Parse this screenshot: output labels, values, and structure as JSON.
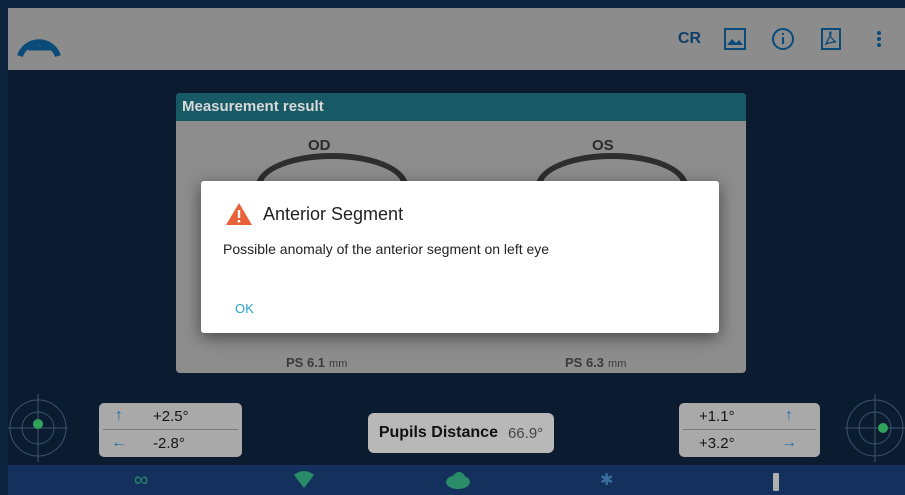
{
  "header": {
    "cr_label": "CR",
    "icons": [
      "app-logo",
      "gallery-icon",
      "info-icon",
      "pdf-icon",
      "more-vert-icon"
    ]
  },
  "card": {
    "title": "Measurement result",
    "od_label": "OD",
    "os_label": "OS",
    "od_ps_label": "PS",
    "od_ps_value": "6.1",
    "od_ps_unit": "mm",
    "os_ps_label": "PS",
    "os_ps_value": "6.3",
    "os_ps_unit": "mm"
  },
  "dialog": {
    "title": "Anterior Segment",
    "message": "Possible anomaly of the anterior segment on left eye",
    "ok_label": "OK",
    "warning_color": "#e8623a"
  },
  "left_ctrl": {
    "up_value": "+2.5°",
    "left_value": "-2.8°"
  },
  "right_ctrl": {
    "up_value": "+1.1°",
    "right_value": "+3.2°"
  },
  "pupils": {
    "label": "Pupils Distance",
    "value": "66.9°"
  },
  "colors": {
    "accent": "#175a66",
    "link": "#2ca1c5",
    "footer_icons": "#2a8c68"
  }
}
